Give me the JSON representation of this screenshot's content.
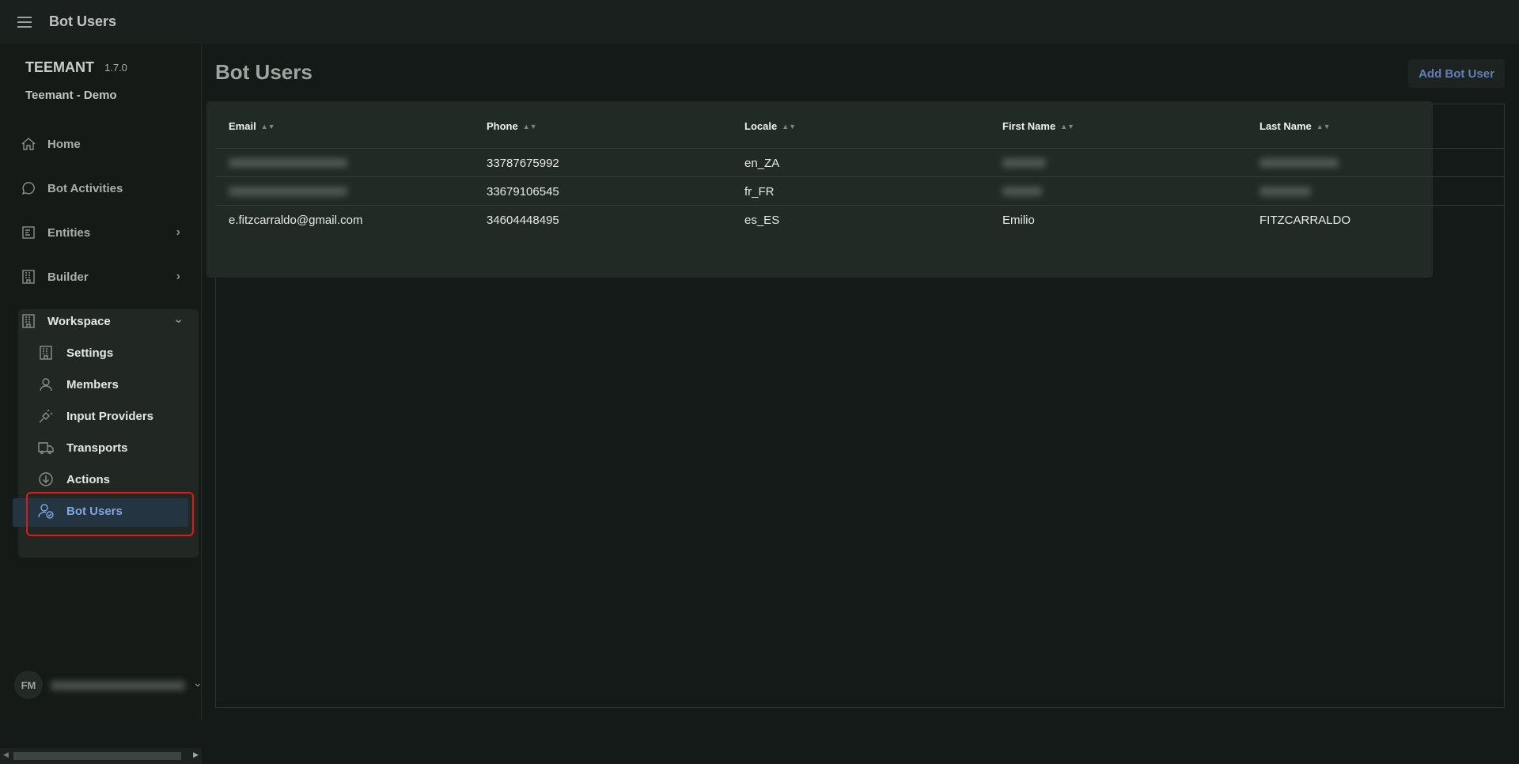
{
  "topbar": {
    "title": "Bot Users"
  },
  "sidebar": {
    "brand": "TEEMANT",
    "version": "1.7.0",
    "org": "Teemant - Demo",
    "items": [
      {
        "label": "Home"
      },
      {
        "label": "Bot Activities"
      },
      {
        "label": "Entities"
      },
      {
        "label": "Builder"
      },
      {
        "label": "Workspace"
      }
    ],
    "workspace_items": [
      {
        "label": "Settings"
      },
      {
        "label": "Members"
      },
      {
        "label": "Input Providers"
      },
      {
        "label": "Transports"
      },
      {
        "label": "Actions"
      },
      {
        "label": "Bot Users"
      }
    ],
    "user_initials": "FM"
  },
  "main": {
    "title": "Bot Users",
    "add_button": "Add Bot User",
    "columns": [
      "Email",
      "Phone",
      "Locale",
      "First Name",
      "Last Name"
    ],
    "rows": [
      {
        "email": null,
        "phone": "33787675992",
        "locale": "en_ZA",
        "first": null,
        "last": null
      },
      {
        "email": null,
        "phone": "33679106545",
        "locale": "fr_FR",
        "first": null,
        "last": null
      },
      {
        "email": "e.fitzcarraldo@gmail.com",
        "phone": "34604448495",
        "locale": "es_ES",
        "first": "Emilio",
        "last": "FITZCARRALDO"
      }
    ]
  },
  "colors": {
    "accent": "#5f7fb6",
    "active_bg": "#243541",
    "highlight": "#e01919"
  }
}
